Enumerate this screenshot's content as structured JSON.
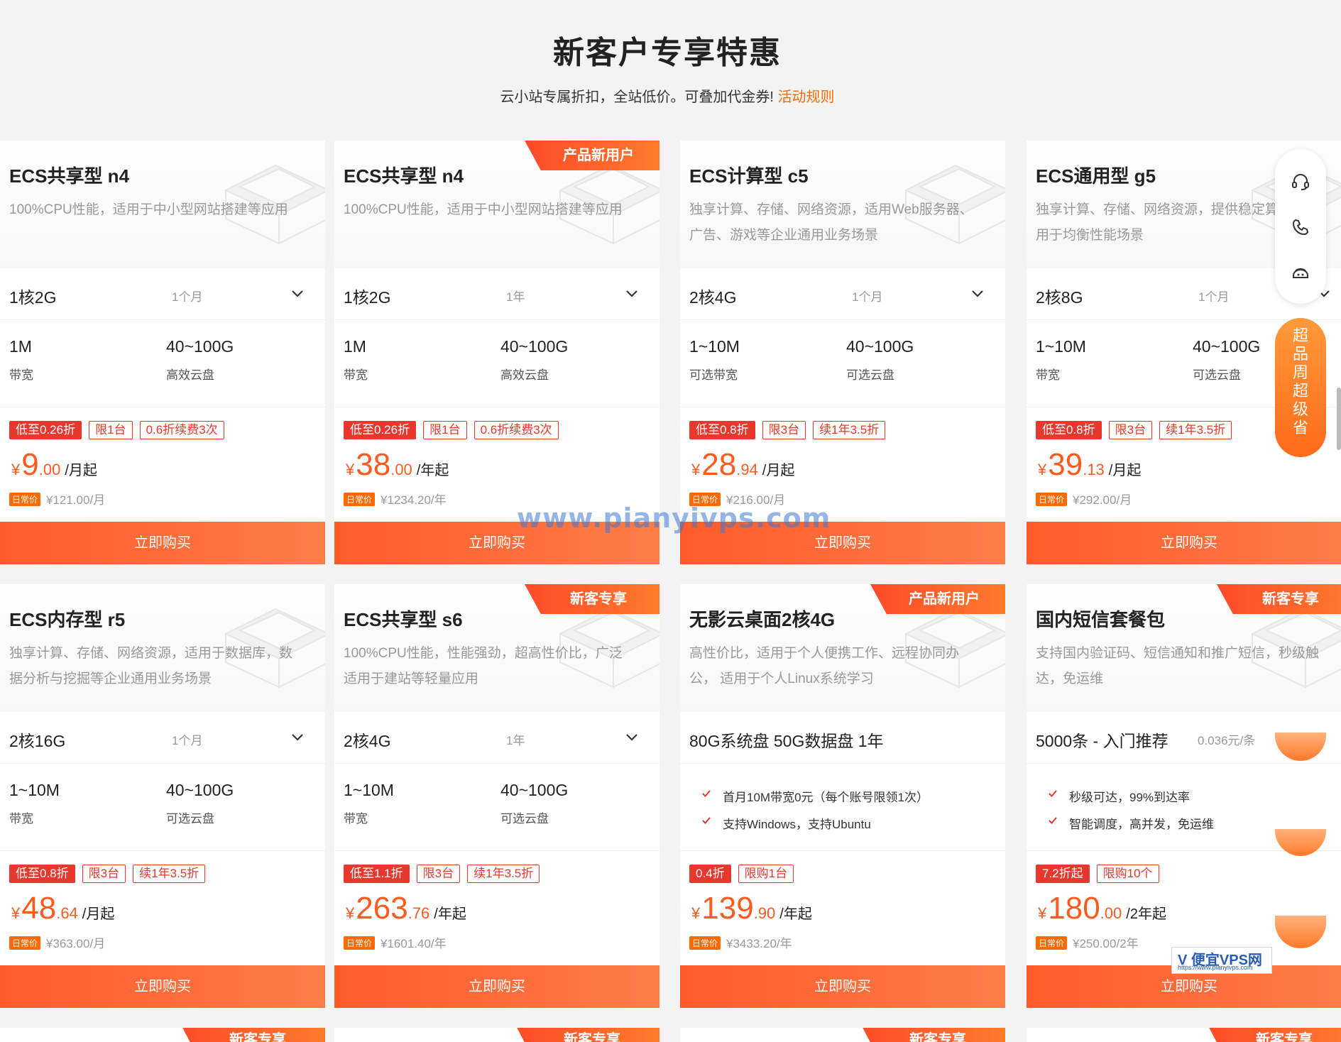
{
  "header": {
    "title": "新客户专享特惠",
    "subtitle": "云小站专属折扣，全站低价。可叠加代金券!",
    "rule_link": "活动规则"
  },
  "common": {
    "buy_label": "立即购买",
    "orig_tag": "日常价",
    "currency": "¥"
  },
  "cards": [
    {
      "title": "ECS共享型 n4",
      "desc": "100%CPU性能，适用于中小型网站搭建等应用",
      "badge": "",
      "spec": "1核2G",
      "duration": "1个月",
      "m1_val": "1M",
      "m1_lbl": "带宽",
      "m2_val": "40~100G",
      "m2_lbl": "高效云盘",
      "tag1": "低至0.26折",
      "tag2": "限1台",
      "tag3": "0.6折续费3次",
      "price_int": "9",
      "price_dec": ".00",
      "price_unit": "/月起",
      "orig_price": "¥121.00/月"
    },
    {
      "title": "ECS共享型 n4",
      "desc": "100%CPU性能，适用于中小型网站搭建等应用",
      "badge": "产品新用户",
      "spec": "1核2G",
      "duration": "1年",
      "m1_val": "1M",
      "m1_lbl": "带宽",
      "m2_val": "40~100G",
      "m2_lbl": "高效云盘",
      "tag1": "低至0.26折",
      "tag2": "限1台",
      "tag3": "0.6折续费3次",
      "price_int": "38",
      "price_dec": ".00",
      "price_unit": "/年起",
      "orig_price": "¥1234.20/年"
    },
    {
      "title": "ECS计算型 c5",
      "desc": "独享计算、存储、网络资源，适用Web服务器、广告、游戏等企业通用业务场景",
      "badge": "",
      "spec": "2核4G",
      "duration": "1个月",
      "m1_val": "1~10M",
      "m1_lbl": "可选带宽",
      "m2_val": "40~100G",
      "m2_lbl": "可选云盘",
      "tag1": "低至0.8折",
      "tag2": "限3台",
      "tag3": "续1年3.5折",
      "price_int": "28",
      "price_dec": ".94",
      "price_unit": "/月起",
      "orig_price": "¥216.00/月"
    },
    {
      "title": "ECS通用型 g5",
      "desc": "独享计算、存储、网络资源，提供稳定算力，适用于均衡性能场景",
      "badge": "",
      "spec": "2核8G",
      "duration": "1个月",
      "m1_val": "1~10M",
      "m1_lbl": "带宽",
      "m2_val": "40~100G",
      "m2_lbl": "可选云盘",
      "tag1": "低至0.8折",
      "tag2": "限3台",
      "tag3": "续1年3.5折",
      "price_int": "39",
      "price_dec": ".13",
      "price_unit": "/月起",
      "orig_price": "¥292.00/月"
    },
    {
      "title": "ECS内存型 r5",
      "desc": "独享计算、存储、网络资源，适用于数据库，数据分析与挖掘等企业通用业务场景",
      "badge": "",
      "spec": "2核16G",
      "duration": "1个月",
      "m1_val": "1~10M",
      "m1_lbl": "带宽",
      "m2_val": "40~100G",
      "m2_lbl": "可选云盘",
      "tag1": "低至0.8折",
      "tag2": "限3台",
      "tag3": "续1年3.5折",
      "price_int": "48",
      "price_dec": ".64",
      "price_unit": "/月起",
      "orig_price": "¥363.00/月"
    },
    {
      "title": "ECS共享型 s6",
      "desc": "100%CPU性能，性能强劲，超高性价比，广泛适用于建站等轻量应用",
      "badge": "新客专享",
      "spec": "2核4G",
      "duration": "1年",
      "m1_val": "1~10M",
      "m1_lbl": "带宽",
      "m2_val": "40~100G",
      "m2_lbl": "可选云盘",
      "tag1": "低至1.1折",
      "tag2": "限3台",
      "tag3": "续1年3.5折",
      "price_int": "263",
      "price_dec": ".76",
      "price_unit": "/年起",
      "orig_price": "¥1601.40/年"
    },
    {
      "title": "无影云桌面2核4G",
      "desc": "高性价比，适用于个人便携工作、远程协同办公， 适用于个人Linux系统学习",
      "badge": "产品新用户",
      "spec": "80G系统盘 50G数据盘 1年",
      "feat1": "首月10M带宽0元（每个账号限领1次）",
      "feat2": "支持Windows，支持Ubuntu",
      "tag1": "0.4折",
      "tag2": "限购1台",
      "price_int": "139",
      "price_dec": ".90",
      "price_unit": "/年起",
      "orig_price": "¥3433.20/年"
    },
    {
      "title": "国内短信套餐包",
      "desc": "支持国内验证码、短信通知和推广短信，秒级触达，免运维",
      "badge": "新客专享",
      "spec": "5000条 - 入门推荐",
      "spec_side": "0.036元/条",
      "feat1": "秒级可达，99%到达率",
      "feat2": "智能调度，高并发，免运维",
      "tag1": "7.2折起",
      "tag2": "限购10个",
      "price_int": "180",
      "price_dec": ".00",
      "price_unit": "/2年起",
      "orig_price": "¥250.00/2年"
    }
  ],
  "bottom_badges": [
    "新客专享",
    "新客专享",
    "新客专享",
    "新客专享"
  ],
  "float_promo": [
    "超",
    "品",
    "周",
    "超",
    "级",
    "省"
  ],
  "watermark": "www.pianyivps.com",
  "logo": {
    "line1": "V 便宜VPS网",
    "line2": "https://www.pianyivps.com"
  },
  "icons": [
    "headset-icon",
    "phone-icon",
    "chat-bot-icon",
    "chevron-down-icon",
    "check-icon"
  ]
}
